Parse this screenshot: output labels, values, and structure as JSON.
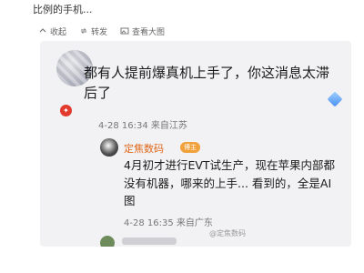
{
  "header": {
    "title": "比例的手机..."
  },
  "actions": [
    {
      "label": "收起",
      "icon": "collapse-icon"
    },
    {
      "label": "转发",
      "icon": "repost-icon"
    },
    {
      "label": "查看大图",
      "icon": "image-icon"
    }
  ],
  "comment": {
    "text": "都有人提前爆真机上手了，你这消息太滞后了",
    "time": "4-28 16:34",
    "location": "来自江苏"
  },
  "reply": {
    "author": "定焦数码",
    "badge": "博主",
    "text": "4月初才进行EVT试生产，现在苹果内部都没有机器，哪来的上手... 看到的，全是AI图",
    "time": "4-28 16:35",
    "location": "来自广东"
  },
  "watermark": "@定焦数码",
  "colors": {
    "author": "#e0671a",
    "badge": "#f0a13a",
    "card_bg": "#f2f2f4"
  }
}
